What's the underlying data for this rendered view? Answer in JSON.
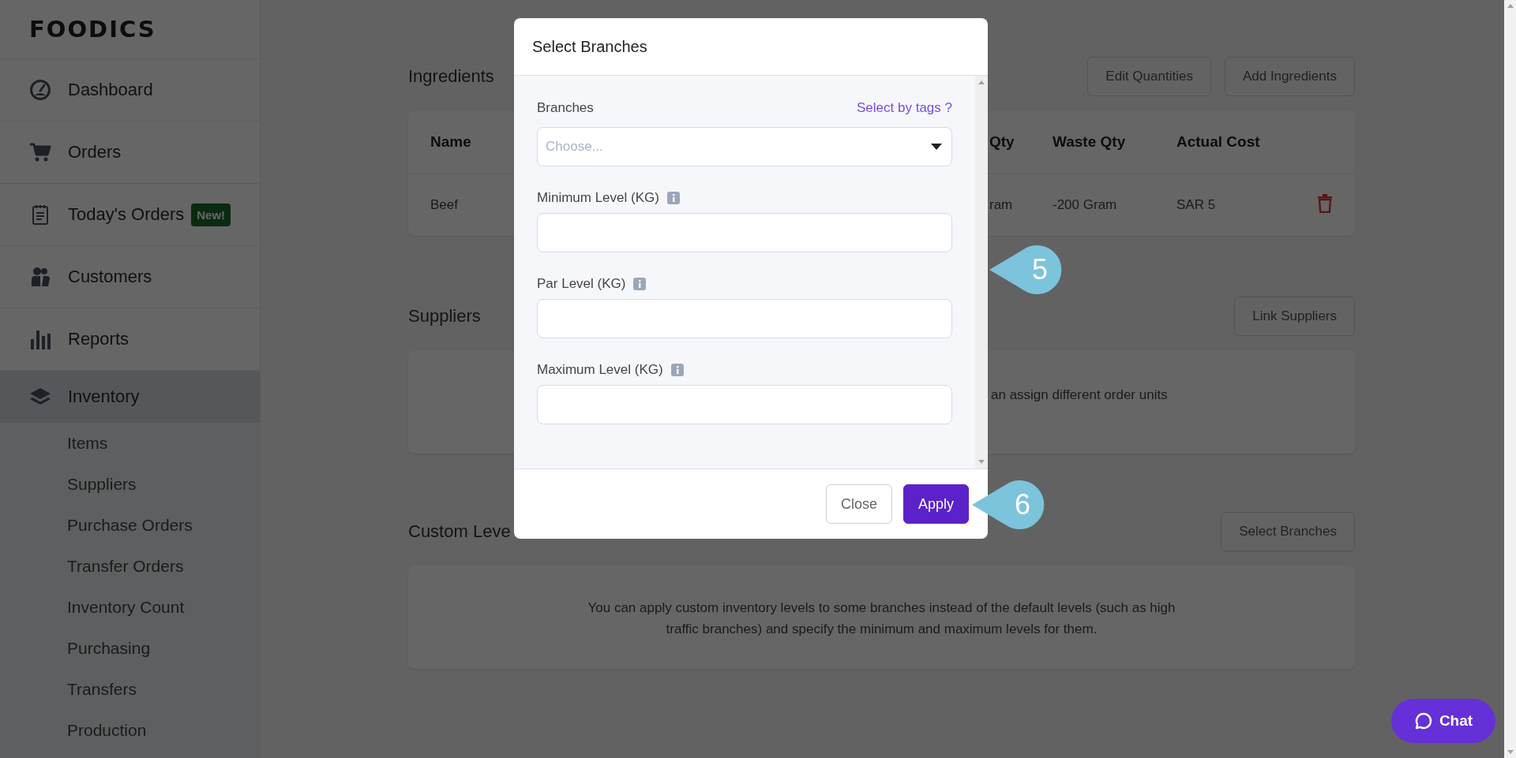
{
  "sidebar": {
    "logo": "FOODICS",
    "items": [
      {
        "label": "Dashboard"
      },
      {
        "label": "Orders"
      },
      {
        "label": "Today's Orders",
        "badge": "New!"
      },
      {
        "label": "Customers"
      },
      {
        "label": "Reports"
      }
    ],
    "inventory": {
      "label": "Inventory",
      "expanded": true,
      "children": [
        {
          "label": "Items"
        },
        {
          "label": "Suppliers"
        },
        {
          "label": "Purchase Orders"
        },
        {
          "label": "Transfer Orders"
        },
        {
          "label": "Inventory Count"
        },
        {
          "label": "Purchasing"
        },
        {
          "label": "Transfers"
        },
        {
          "label": "Production"
        }
      ]
    }
  },
  "ingredients": {
    "title": "Ingredients",
    "buttons": [
      "Edit Quantities",
      "Add Ingredients"
    ],
    "columns": [
      "Name",
      "Qty",
      "Waste Qty",
      "Actual Cost"
    ],
    "rows": [
      {
        "cells": [
          "Beef",
          "ram",
          "-200 Gram",
          "SAR 5"
        ]
      }
    ]
  },
  "suppliers": {
    "title": "Suppliers",
    "buttons": [
      "Link Suppliers"
    ],
    "note": "an assign different order units"
  },
  "custom_levels": {
    "title": "Custom Leve",
    "buttons": [
      "Select Branches"
    ],
    "note": "You can apply custom inventory levels to some branches instead of the default levels (such as high traffic branches) and specify the minimum and maximum levels for them."
  },
  "modal": {
    "title": "Select Branches",
    "branches": {
      "label": "Branches",
      "link": "Select by tags ?",
      "placeholder": "Choose..."
    },
    "fields": [
      {
        "label": "Minimum Level (KG)"
      },
      {
        "label": "Par Level (KG)"
      },
      {
        "label": "Maximum Level (KG)"
      }
    ],
    "buttons": [
      {
        "label": "Close",
        "kind": "secondary"
      },
      {
        "label": "Apply",
        "kind": "primary"
      }
    ]
  },
  "callouts": [
    {
      "number": "5"
    },
    {
      "number": "6"
    }
  ],
  "chat": {
    "label": "Chat"
  }
}
